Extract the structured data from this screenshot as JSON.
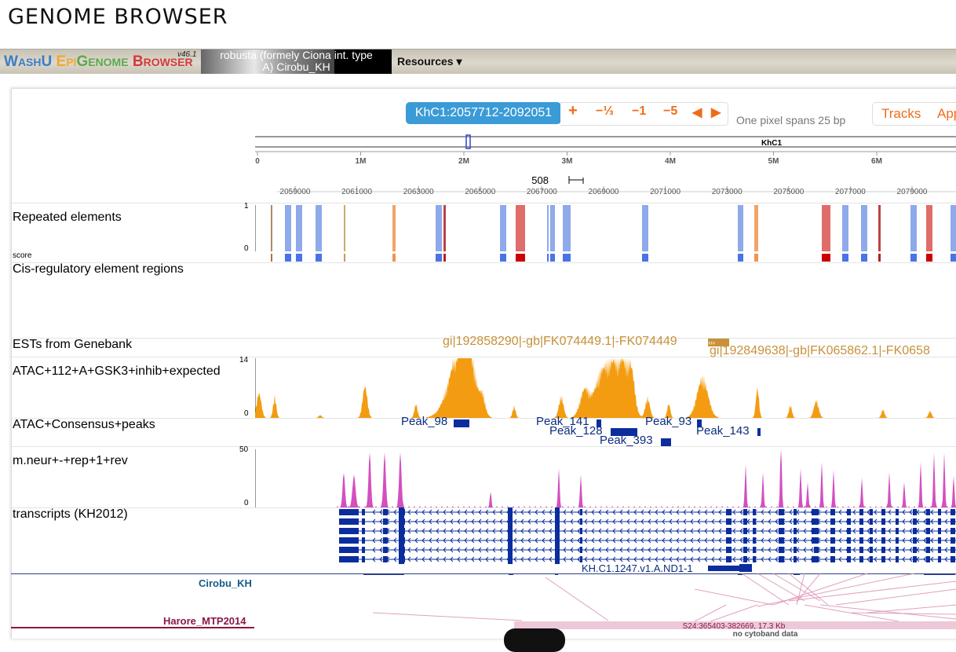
{
  "app": {
    "site_title": "GENOME BROWSER",
    "brand_w": "W",
    "brand_ashu": "ASH",
    "brand_u": "U",
    "brand_e": "E",
    "brand_pi": "PI",
    "brand_g": "G",
    "brand_enome": "ENOME",
    "brand_b": "B",
    "brand_rowser": "ROWSER",
    "version": "v46.1",
    "genome_line1": "robusta (formely Ciona int. type",
    "genome_line2": "A) Cirobu_KH",
    "resources": "Resources ▾"
  },
  "nav": {
    "region": "KhC1:2057712-2092051",
    "zoom_in": "+",
    "zoom_out_third": "−⅓",
    "zoom_out_1": "−1",
    "zoom_out_5": "−5",
    "pan_left": "◀",
    "pan_right": "▶",
    "pixel_span": "One pixel spans 25 bp",
    "tracks": "Tracks",
    "apps": "Apps"
  },
  "chromosome": {
    "name": "KhC1",
    "ticks": [
      "0",
      "1M",
      "2M",
      "3M",
      "4M",
      "5M",
      "6M"
    ]
  },
  "ruler": {
    "scale_label": "508",
    "ticks": [
      "2059000",
      "2061000",
      "2063000",
      "2065000",
      "2067000",
      "2069000",
      "2071000",
      "2073000",
      "2075000",
      "2077000",
      "2079000"
    ]
  },
  "tracks": {
    "repeats": {
      "label": "Repeated elements",
      "sublabel": "score",
      "max": "1",
      "min": "0"
    },
    "cre": {
      "label": "Cis-regulatory element regions"
    },
    "ests": {
      "label": "ESTs from Genebank",
      "feature1": "gi|192858290|-gb|FK074449.1|-FK074449",
      "feature2": "gi|192849638|-gb|FK065862.1|-FK0658"
    },
    "atac": {
      "label": "ATAC+112+A+GSK3+inhib+expected",
      "max": "14",
      "min": "0"
    },
    "peaks": {
      "label": "ATAC+Consensus+peaks",
      "p1": "Peak_98",
      "p2": "Peak_141",
      "p3": "Peak_128",
      "p4": "Peak_393",
      "p5": "Peak_93",
      "p6": "Peak_143"
    },
    "mneur": {
      "label": "m.neur+-+rep+1+rev",
      "max": "50",
      "min": "0"
    },
    "transcripts": {
      "label": "transcripts (KH2012)",
      "gene": "KH.C1.1247.v1.A.ND1-1"
    },
    "genomealign": {
      "label1": "Cirobu_KH",
      "label2": "Harore_MTP2014",
      "query": "S24:365403-382669, 17.3 Kb",
      "cyto": "no cytoband data"
    }
  },
  "colors": {
    "accent": "#ef6c17",
    "region_bg": "#3b9bd6",
    "atac": "#f39c12",
    "mneur": "#d34fbf",
    "transcript": "#0b2d9e",
    "est": "#c8913a",
    "repeat_blue": "#7b9be6",
    "repeat_red": "#d9534f",
    "repeat_orange": "#f0944e"
  }
}
